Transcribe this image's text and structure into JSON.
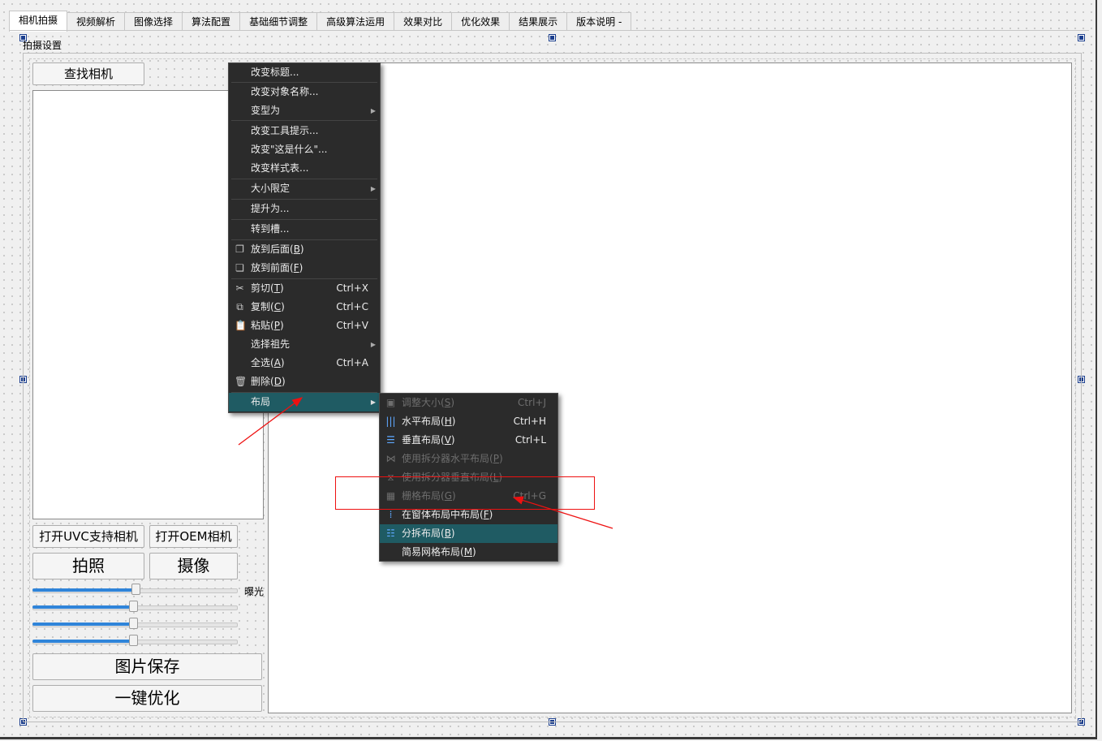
{
  "tabs": [
    "相机拍摄",
    "视频解析",
    "图像选择",
    "算法配置",
    "基础细节调整",
    "高级算法运用",
    "效果对比",
    "优化效果",
    "结果展示",
    "版本说明 -"
  ],
  "active_tab": 0,
  "groupbox_title": "拍摄设置",
  "buttons": {
    "find_camera": "查找相机",
    "open_uvc": "打开UVC支持相机",
    "open_oem": "打开OEM相机",
    "take_photo": "拍照",
    "record": "摄像",
    "save_image": "图片保存",
    "one_key_optimize": "一键优化"
  },
  "exposure_label": "曝光",
  "sliders": [
    {
      "value_pct": 50
    },
    {
      "value_pct": 49
    },
    {
      "value_pct": 49
    },
    {
      "value_pct": 49
    }
  ],
  "context_menu": {
    "change_title": "改变标题...",
    "change_object_name": "改变对象名称...",
    "morph_into": "变型为",
    "change_tooltip": "改变工具提示...",
    "change_whats_this": "改变\"这是什么\"...",
    "change_stylesheet": "改变样式表...",
    "size_constraints": "大小限定",
    "promote_to": "提升为...",
    "go_to_slot": "转到槽...",
    "send_to_back": "放到后面(",
    "send_to_back_key": "B",
    "bring_to_front": "放到前面(",
    "bring_to_front_key": "F",
    "cut": "剪切(",
    "cut_key": "T",
    "cut_shortcut": "Ctrl+X",
    "copy": "复制(",
    "copy_key": "C",
    "copy_shortcut": "Ctrl+C",
    "paste": "粘贴(",
    "paste_key": "P",
    "paste_shortcut": "Ctrl+V",
    "select_ancestor": "选择祖先",
    "select_all": "全选(",
    "select_all_key": "A",
    "select_all_shortcut": "Ctrl+A",
    "delete": "删除(",
    "delete_key": "D",
    "layout": "布局",
    "close_paren": ")"
  },
  "layout_submenu": {
    "adjust_size": "调整大小(",
    "adjust_size_key": "S",
    "adjust_size_shortcut": "Ctrl+J",
    "horizontal": "水平布局(",
    "horizontal_key": "H",
    "horizontal_shortcut": "Ctrl+H",
    "vertical": "垂直布局(",
    "vertical_key": "V",
    "vertical_shortcut": "Ctrl+L",
    "splitter_h": "使用拆分器水平布局(",
    "splitter_h_key": "P",
    "splitter_v": "使用拆分器垂直布局(",
    "splitter_v_key": "L",
    "grid": "栅格布局(",
    "grid_key": "G",
    "grid_shortcut": "Ctrl+G",
    "form": "在窗体布局中布局(",
    "form_key": "F",
    "break": "分拆布局(",
    "break_key": "B",
    "simple_grid": "简易网格布局(",
    "simple_grid_key": "M",
    "close_paren": ")"
  },
  "colors": {
    "menu_bg": "#2b2b2b",
    "menu_highlight": "#1f5b63",
    "annotation": "#e11111",
    "slider_fill": "#2f84d9"
  }
}
